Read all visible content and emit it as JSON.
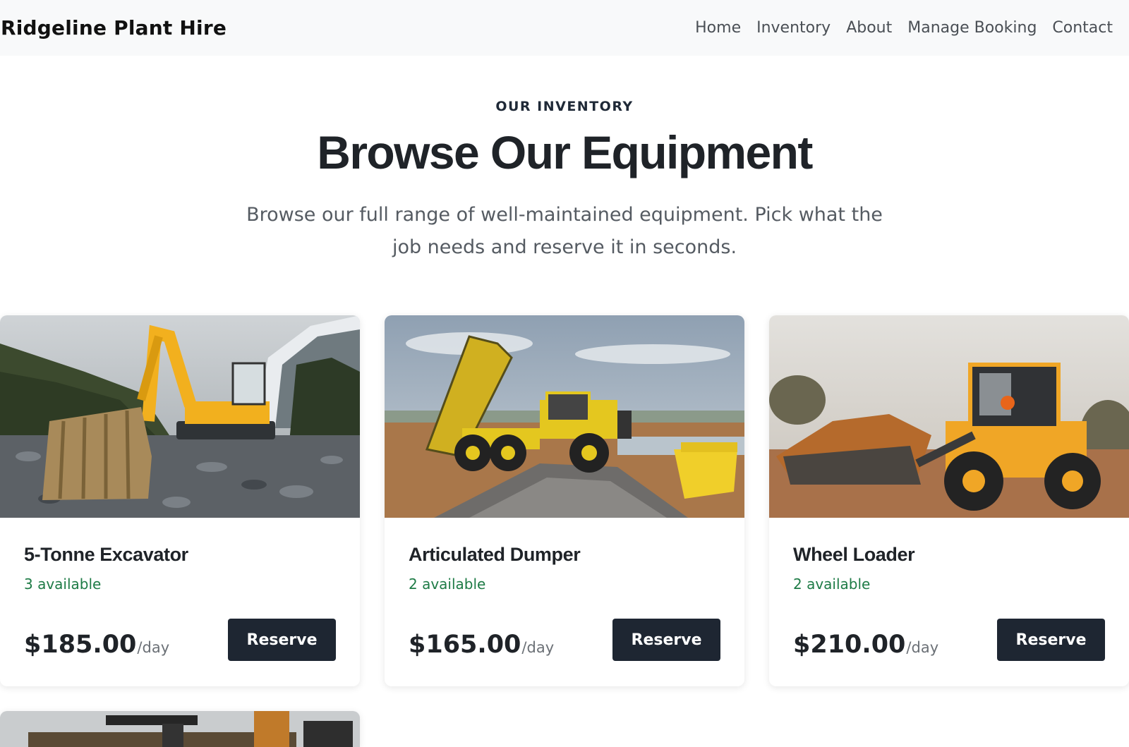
{
  "nav": {
    "brand": "Ridgeline Plant Hire",
    "links": [
      "Home",
      "Inventory",
      "About",
      "Manage Booking",
      "Contact"
    ]
  },
  "hero": {
    "eyebrow": "OUR INVENTORY",
    "title": "Browse Our Equipment",
    "subtitle": "Browse our full range of well-maintained equipment. Pick what the job needs and reserve it in seconds."
  },
  "products": [
    {
      "name": "5-Tonne Excavator",
      "availability": "3 available",
      "price": "$185.00",
      "unit": "/day",
      "button": "Reserve"
    },
    {
      "name": "Articulated Dumper",
      "availability": "2 available",
      "price": "$165.00",
      "unit": "/day",
      "button": "Reserve"
    },
    {
      "name": "Wheel Loader",
      "availability": "2 available",
      "price": "$210.00",
      "unit": "/day",
      "button": "Reserve"
    }
  ],
  "colors": {
    "nav_bg": "#f8f9fa",
    "availability_green": "#1e7b46",
    "button_dark": "#1e2632",
    "machine_yellow": "#f2b01e"
  }
}
